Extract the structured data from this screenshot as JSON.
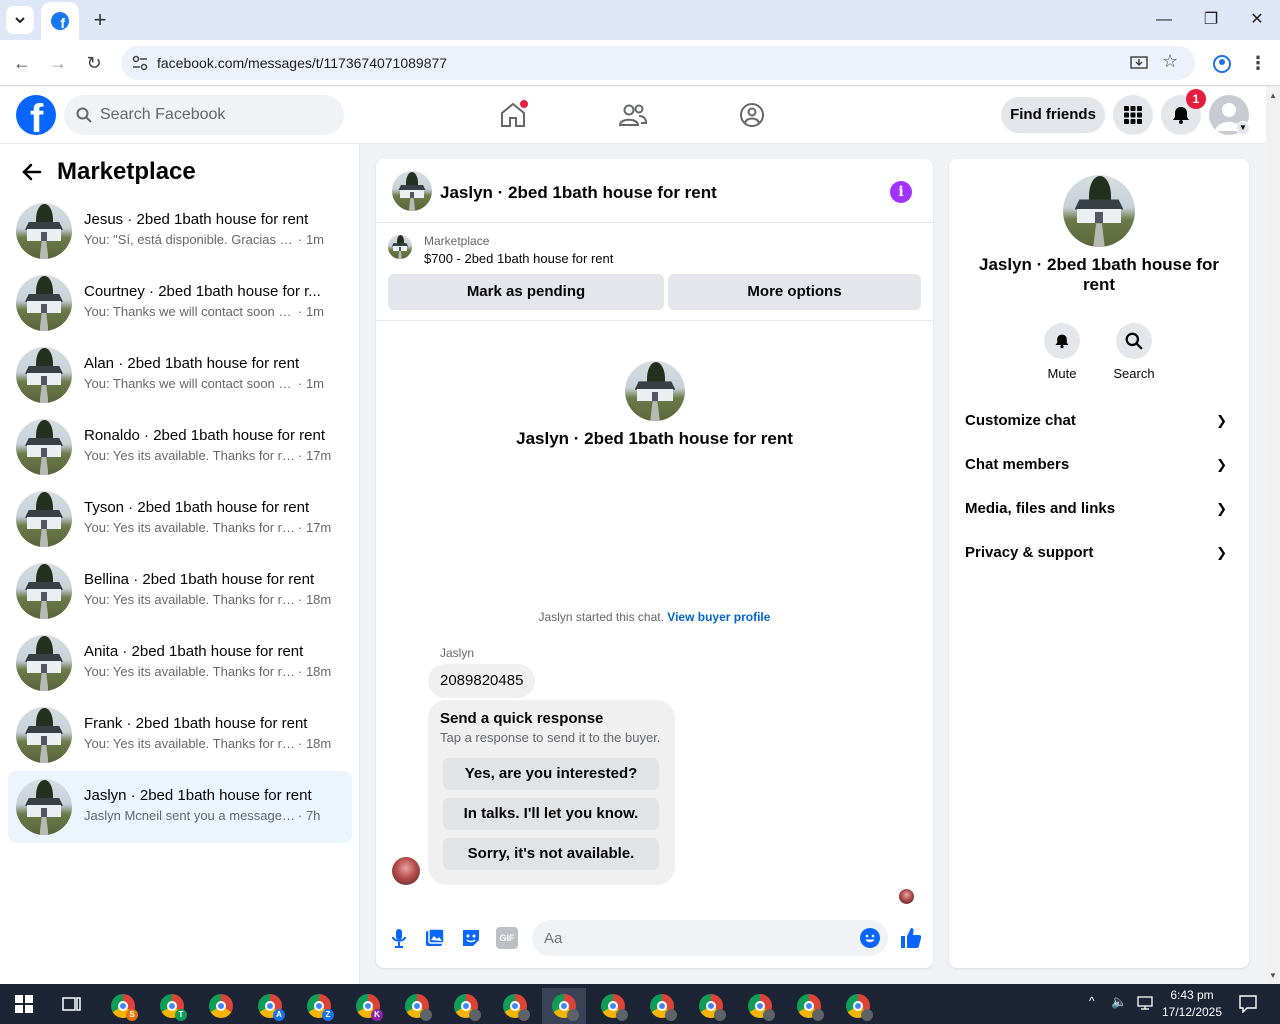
{
  "browser": {
    "url": "facebook.com/messages/t/1173674071089877",
    "new_tab": "+"
  },
  "header": {
    "search_placeholder": "Search Facebook",
    "find_friends": "Find friends",
    "notification_count": "1"
  },
  "sidebar": {
    "title": "Marketplace",
    "conversations": [
      {
        "name": "Jesus · 2bed 1bath house for rent",
        "preview": "You: \"Sí, está disponible. Gracias por ...",
        "time": "· 1m"
      },
      {
        "name": "Courtney · 2bed 1bath house for r...",
        "preview": "You: Thanks we will contact soon wit...",
        "time": "· 1m"
      },
      {
        "name": "Alan · 2bed 1bath house for rent",
        "preview": "You: Thanks we will contact soon wit...",
        "time": "· 1m"
      },
      {
        "name": "Ronaldo · 2bed 1bath house for rent",
        "preview": "You: Yes its available. Thanks for rea...",
        "time": "· 17m"
      },
      {
        "name": "Tyson · 2bed 1bath house for rent",
        "preview": "You: Yes its available. Thanks for rea...",
        "time": "· 17m"
      },
      {
        "name": "Bellina · 2bed 1bath house for rent",
        "preview": "You: Yes its available. Thanks for rea...",
        "time": "· 18m"
      },
      {
        "name": "Anita · 2bed 1bath house for rent",
        "preview": "You: Yes its available. Thanks for rea...",
        "time": "· 18m"
      },
      {
        "name": "Frank · 2bed 1bath house for rent",
        "preview": "You: Yes its available. Thanks for rea...",
        "time": "· 18m"
      },
      {
        "name": "Jaslyn · 2bed 1bath house for rent",
        "preview": "Jaslyn Mcneil sent you a message abo...",
        "time": "· 7h"
      }
    ]
  },
  "chat": {
    "title": "Jaslyn · 2bed 1bath house for rent",
    "marketplace_label": "Marketplace",
    "listing": "$700 - 2bed 1bath house for rent",
    "mark_pending": "Mark as pending",
    "more_options": "More options",
    "intro_title": "Jaslyn · 2bed 1bath house for rent",
    "started_text": "Jaslyn started this chat. ",
    "view_buyer_profile": "View buyer profile",
    "sender": "Jaslyn",
    "message": "2089820485",
    "quick_title": "Send a quick response",
    "quick_sub": "Tap a response to send it to the buyer.",
    "quick_options": [
      "Yes, are you interested?",
      "In talks. I'll let you know.",
      "Sorry, it's not available."
    ],
    "input_placeholder": "Aa",
    "gif_label": "GIF"
  },
  "details": {
    "title": "Jaslyn · 2bed 1bath house for rent",
    "mute": "Mute",
    "search": "Search",
    "rows": [
      "Customize chat",
      "Chat members",
      "Media, files and links",
      "Privacy & support"
    ]
  },
  "taskbar": {
    "time": "6:43 pm",
    "date": "17/12/2025",
    "app_badges": [
      "S",
      "T",
      "",
      "A",
      "Z",
      "K"
    ]
  },
  "colors": {
    "fb_blue": "#0866ff",
    "link_blue": "#0064d1",
    "info_purple": "#a033ff",
    "notif_red": "#e41e3f",
    "active_conv": "#ebf5ff"
  }
}
